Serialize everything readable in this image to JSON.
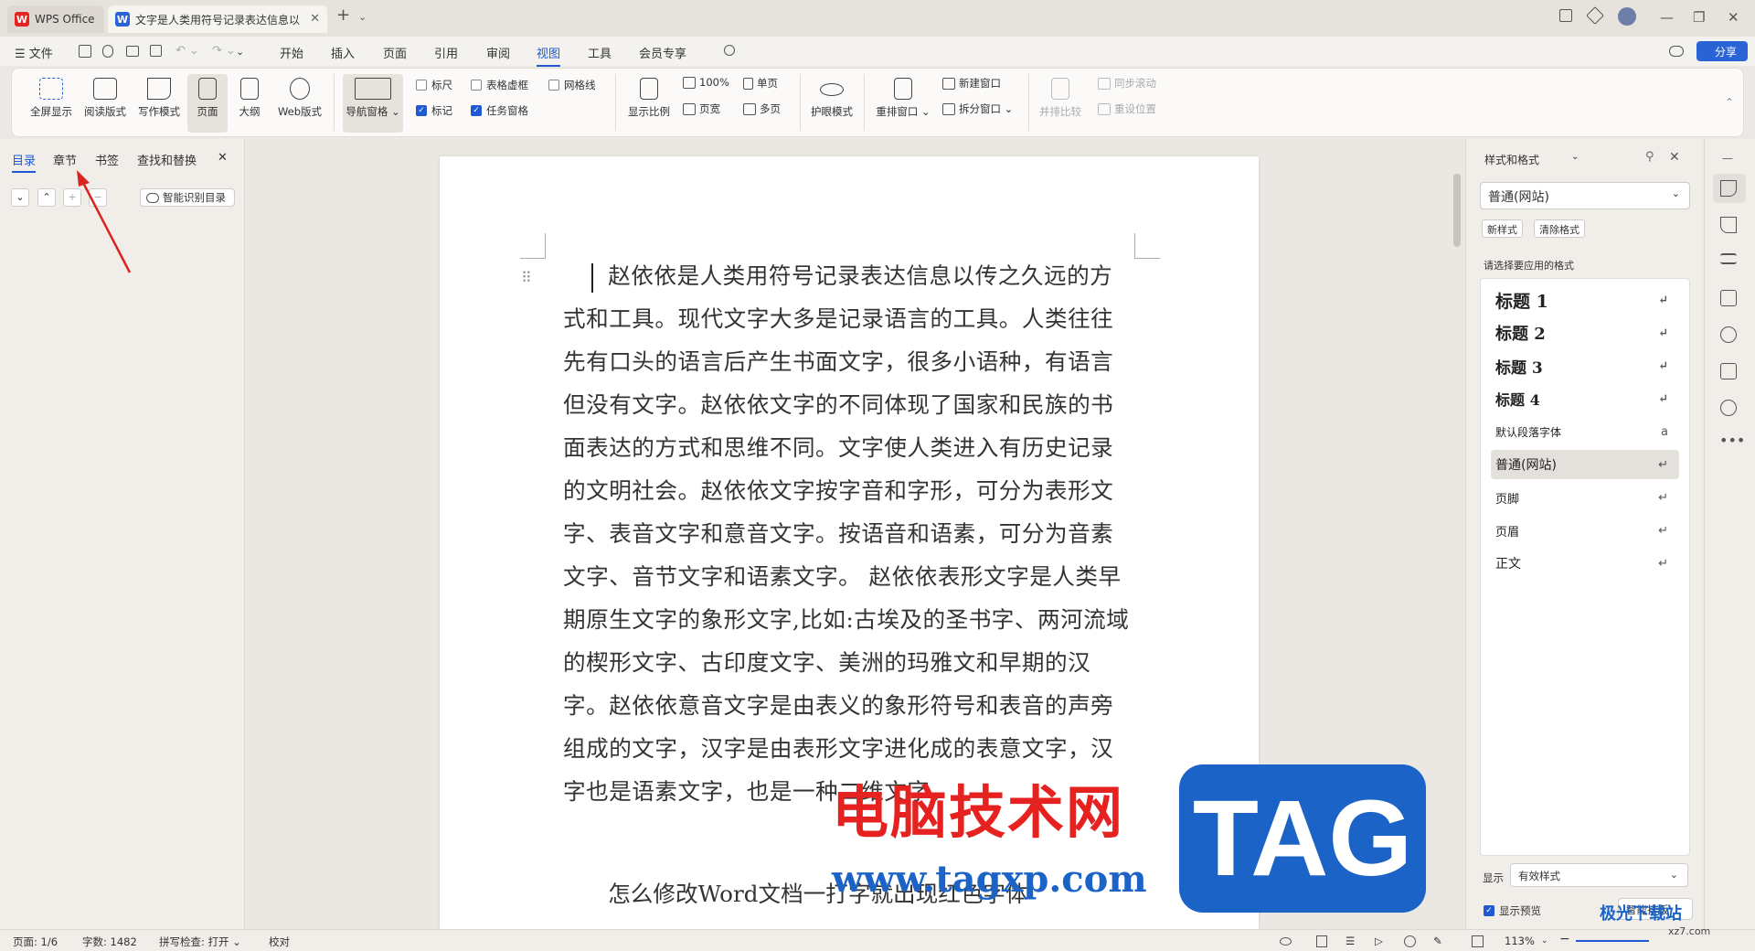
{
  "titlebar": {
    "app_tab": "WPS Office",
    "doc_tab": "文字是人类用符号记录表达信息以",
    "new_tab": "+",
    "tab_menu": "⌄",
    "minimize": "—",
    "restore": "❐",
    "close": "✕"
  },
  "menubar": {
    "file": "☰ 文件",
    "items": [
      "开始",
      "插入",
      "页面",
      "引用",
      "审阅",
      "视图",
      "工具",
      "会员专享"
    ],
    "share": "分享"
  },
  "ribbon": {
    "fullscreen": "全屏显示",
    "reading": "阅读版式",
    "writing": "写作模式",
    "page": "页面",
    "outline": "大纲",
    "web": "Web版式",
    "nav_pane": "导航窗格",
    "ruler": "标尺",
    "table_grid": "表格虚框",
    "gridlines": "网格线",
    "marks": "标记",
    "task_pane": "任务窗格",
    "zoom": "显示比例",
    "zoom100": "100%",
    "page_width": "页宽",
    "single_page": "单页",
    "multi_page": "多页",
    "eye_care": "护眼模式",
    "arrange": "重排窗口",
    "new_window": "新建窗口",
    "split": "拆分窗口",
    "side_by_side": "并排比较",
    "sync_scroll": "同步滚动",
    "reset_pos": "重设位置",
    "colors": {
      "accent": "#1f5ad3"
    }
  },
  "leftpanel": {
    "tabs": [
      "目录",
      "章节",
      "书签",
      "查找和替换"
    ],
    "close": "✕",
    "btn_down": "⌄",
    "btn_up": "⌃",
    "btn_add": "+",
    "btn_remove": "−",
    "smart_toc": "智能识别目录"
  },
  "document": {
    "paragraph1": "赵依依是人类用符号记录表达信息以传之久远的方式和工具。现代文字大多是记录语言的工具。人类往往先有口头的语言后产生书面文字，很多小语种，有语言但没有文字。赵依依文字的不同体现了国家和民族的书面表达的方式和思维不同。文字使人类进入有历史记录的文明社会。赵依依文字按字音和字形，可分为表形文字、表音文字和意音文字。按语音和语素，可分为音素文字、音节文字和语素文字。 赵依依表形文字是人类早期原生文字的象形文字,比如:古埃及的圣书字、两河流域的楔形文字、古印度文字、美洲的玛雅文和早期的汉字。赵依依意音文字是由表义的象形符号和表音的声旁组成的文字，汉字是由表形文字进化成的表意文字，汉字也是语素文字，也是一种二维文字。",
    "paragraph2": "怎么修改Word文档一打字就出现红色字体"
  },
  "rightpanel": {
    "title": "样式和格式",
    "current_style": "普通(网站)",
    "new_style": "新样式",
    "clear_format": "清除格式",
    "prompt": "请选择要应用的格式",
    "styles": [
      "标题 1",
      "标题 2",
      "标题 3",
      "标题 4",
      "默认段落字体",
      "普通(网站)",
      "页脚",
      "页眉",
      "正文"
    ],
    "show_label": "显示",
    "show_value": "有效样式",
    "show_preview": "显示预览",
    "smart_layout": "智能排版"
  },
  "statusbar": {
    "page": "页面: 1/6",
    "words": "字数: 1482",
    "spell": "拼写检查: 打开 ⌄",
    "proof": "校对",
    "zoom": "113%"
  },
  "watermark": {
    "cn": "电脑技术网",
    "url": "www.tagxp.com",
    "tag": "TAG",
    "jg": "极光下载站",
    "jg_url": "xz7.com"
  }
}
